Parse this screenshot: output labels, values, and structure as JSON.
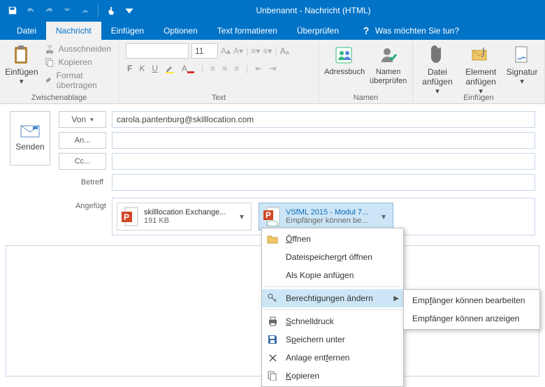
{
  "title": "Unbenannt - Nachricht (HTML)",
  "tellMe": "Was möchten Sie tun?",
  "tabs": {
    "file": "Datei",
    "msg": "Nachricht",
    "insert": "Einfügen",
    "options": "Optionen",
    "format": "Text formatieren",
    "review": "Überprüfen"
  },
  "ribbon": {
    "clipboard": {
      "paste": "Einfügen",
      "cut": "Ausschneiden",
      "copy": "Kopieren",
      "fmtpaint": "Format übertragen",
      "group": "Zwischenablage"
    },
    "font": {
      "size": "11",
      "group": "Text",
      "b": "F",
      "i": "K",
      "u": "U"
    },
    "names": {
      "address": "Adressbuch",
      "check": "Namen\nüberprüfen",
      "group": "Namen"
    },
    "attach": {
      "file": "Datei\nanfügen",
      "item": "Element\nanfügen",
      "sign": "Signatur",
      "group": "Einfügen"
    }
  },
  "compose": {
    "send": "Senden",
    "from": "Von",
    "to": "An...",
    "cc": "Cc...",
    "subject": "Betreff",
    "attached": "Angefügt",
    "fromValue": "carola.pantenburg@skilllocation.com"
  },
  "attachments": [
    {
      "name": "skilllocation Exchange...",
      "sub": "191 KB"
    },
    {
      "name": "VSfML 2015 - Modul 7...",
      "sub": "Empfänger können be..."
    }
  ],
  "ctx": {
    "open": "Öffnen",
    "openLoc": "Dateispeicherort öffnen",
    "asCopy": "Als Kopie anfügen",
    "perm": "Berechtigungen ändern",
    "quick": "Schnelldruck",
    "save": "Speichern unter",
    "remove": "Anlage entfernen",
    "copy": "Kopieren"
  },
  "submenu": {
    "edit": "Empfänger können bearbeiten",
    "view": "Empfänger können anzeigen"
  }
}
